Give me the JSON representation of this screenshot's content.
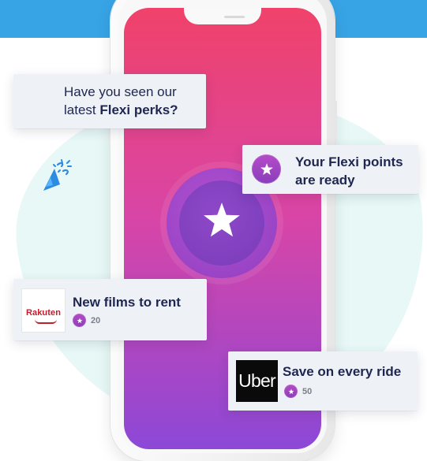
{
  "notifications": {
    "perks": {
      "line1": "Have you seen our",
      "line2_prefix": "latest ",
      "line2_bold": "Flexi perks?",
      "icon": "party-popper-icon"
    },
    "points_ready": {
      "line1": "Your Flexi points",
      "line2": "are ready",
      "icon": "star-badge-icon"
    },
    "films": {
      "title": "New films to rent",
      "points": "20",
      "brand": "Rakuten",
      "icon": "rakuten-logo-icon"
    },
    "ride": {
      "title": "Save on every ride",
      "points": "50",
      "brand": "Uber",
      "icon": "uber-logo-icon"
    }
  },
  "colors": {
    "top_band": "#37a4e6",
    "screen_top": "#f0426a",
    "screen_bottom": "#8c48d7",
    "card_bg": "#eef2f6",
    "text": "#1f2650",
    "points_text": "#7a7f8b",
    "badge_purple": "#9b43be",
    "rakuten_red": "#c31d2c"
  }
}
